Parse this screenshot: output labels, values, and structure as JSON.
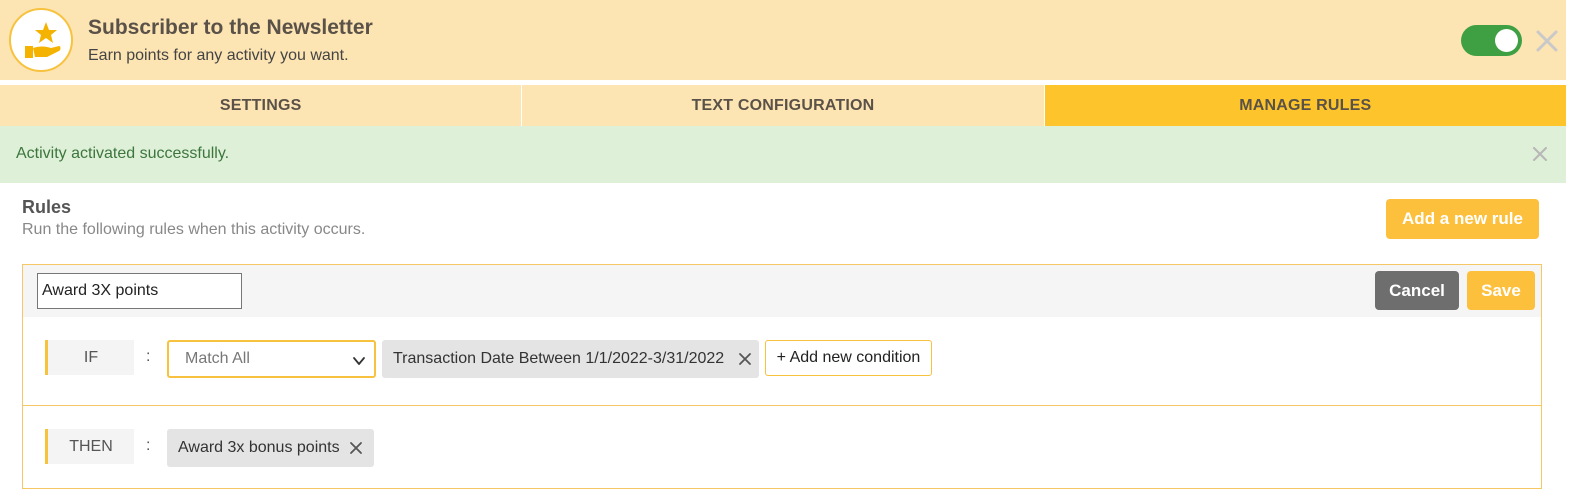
{
  "header": {
    "icon": "hand-star-icon",
    "title": "Subscriber to the Newsletter",
    "subtitle": "Earn points for any activity you want.",
    "toggle_on": true
  },
  "tabs": [
    {
      "label": "SETTINGS",
      "active": false
    },
    {
      "label": "TEXT CONFIGURATION",
      "active": false
    },
    {
      "label": "MANAGE RULES",
      "active": true
    }
  ],
  "alert": {
    "text": "Activity activated successfully."
  },
  "rules": {
    "title": "Rules",
    "subtitle": "Run the following rules when this activity occurs.",
    "add_label": "Add a new rule"
  },
  "rule": {
    "name_value": "Award 3X points",
    "cancel_label": "Cancel",
    "save_label": "Save",
    "if_label": "IF",
    "then_label": "THEN",
    "colon": ":",
    "match_value": "Match All",
    "condition_chip": "Transaction Date Between 1/1/2022-3/31/2022",
    "add_condition_label": "+ Add new condition",
    "action_chip": "Award 3x bonus points"
  },
  "colors": {
    "header_bg": "#fde4b3",
    "accent": "#fdc52b",
    "button": "#fcc03d",
    "toggle": "#3ea043",
    "alert_bg": "#dff0d8",
    "alert_text": "#3c763d"
  }
}
